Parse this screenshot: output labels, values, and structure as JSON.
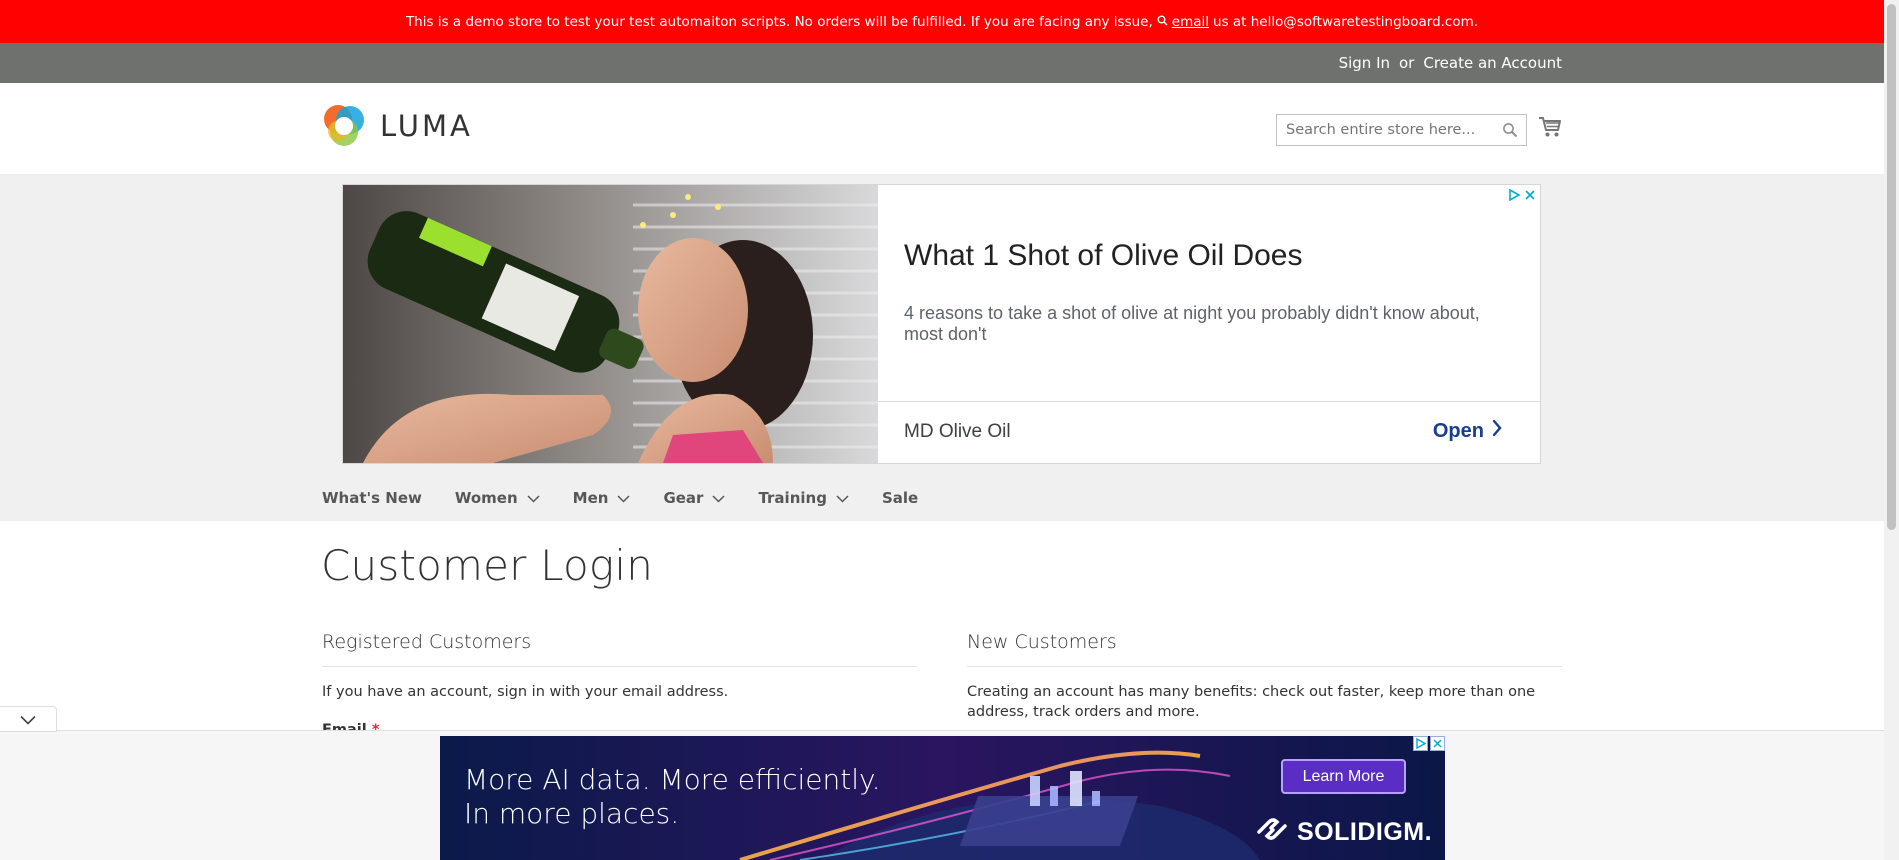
{
  "demo_notice": {
    "text_before": "This is a demo store to test your test automaiton scripts. No orders will be fulfilled. If you are facing any issue,",
    "email_link": "email",
    "text_after": "us at hello@softwaretestingboard.com."
  },
  "panel": {
    "sign_in": "Sign In",
    "or": "or",
    "create_account": "Create an Account"
  },
  "header": {
    "logo_text": "LUMA",
    "search_placeholder": "Search entire store here..."
  },
  "top_ad": {
    "title": "What 1 Shot of Olive Oil Does",
    "description": "4 reasons to take a shot of olive at night you probably didn't know about, most don't",
    "advertiser": "MD Olive Oil",
    "cta": "Open"
  },
  "nav": {
    "items": [
      {
        "label": "What's New",
        "dropdown": false
      },
      {
        "label": "Women",
        "dropdown": true
      },
      {
        "label": "Men",
        "dropdown": true
      },
      {
        "label": "Gear",
        "dropdown": true
      },
      {
        "label": "Training",
        "dropdown": true
      },
      {
        "label": "Sale",
        "dropdown": false
      }
    ]
  },
  "page": {
    "title": "Customer Login",
    "registered": {
      "title": "Registered Customers",
      "text": "If you have an account, sign in with your email address.",
      "email_label": "Email",
      "required_mark": "*"
    },
    "new_customers": {
      "title": "New Customers",
      "text": "Creating an account has many benefits: check out faster, keep more than one address, track orders and more."
    }
  },
  "bottom_ad": {
    "headline_line1": "More AI data. More efficiently.",
    "headline_line2": "In more places.",
    "cta": "Learn More",
    "brand": "SOLIDIGM."
  },
  "colors": {
    "demo_bar": "#ff0101",
    "panel_header": "#6e716e",
    "nav_band": "#f0f0f0",
    "ad_cta_blue": "#1a3d8f",
    "required": "#e02b27"
  }
}
